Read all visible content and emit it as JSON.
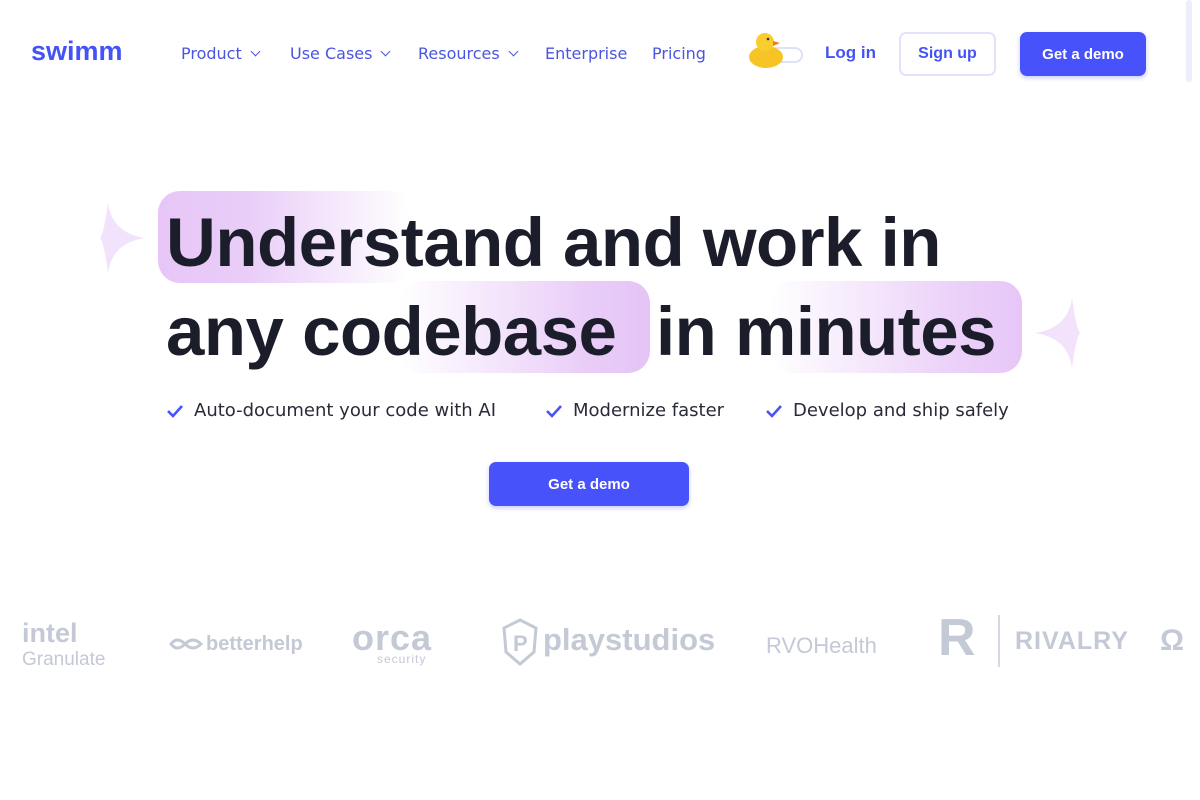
{
  "header": {
    "logo": "swimm",
    "nav": [
      {
        "label": "Product",
        "dropdown": true
      },
      {
        "label": "Use Cases",
        "dropdown": true
      },
      {
        "label": "Resources",
        "dropdown": true
      },
      {
        "label": "Enterprise",
        "dropdown": false
      },
      {
        "label": "Pricing",
        "dropdown": false
      }
    ],
    "login": "Log in",
    "signup": "Sign up",
    "demo": "Get a demo"
  },
  "hero": {
    "line1": "Understand and work in",
    "line2a": "any codebase",
    "line2b": "in minutes",
    "features": [
      "Auto-document your code with AI",
      "Modernize faster",
      "Develop and ship safely"
    ],
    "cta": "Get a demo"
  },
  "logos": [
    "intel",
    "Granulate",
    "betterhelp",
    "orca",
    "security",
    "playstudios",
    "RVOHealth",
    "RIVALRY"
  ],
  "colors": {
    "accent": "#4752fa",
    "highlight": "#e9c9f7",
    "text": "#1c1d2b",
    "logo_gray": "#c4c9d6"
  }
}
